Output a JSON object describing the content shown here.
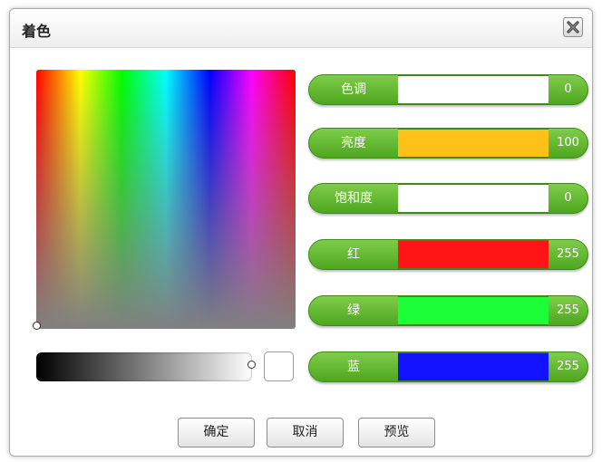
{
  "dialog": {
    "title": "着色",
    "close_icon": "close-x-icon"
  },
  "sliders": [
    {
      "label": "色调",
      "value": "0",
      "track_color": "#ffffff"
    },
    {
      "label": "亮度",
      "value": "100",
      "track_color": "#ffc018"
    },
    {
      "label": "饱和度",
      "value": "0",
      "track_color": "#ffffff"
    },
    {
      "label": "红",
      "value": "255",
      "track_color": "#ff1515"
    },
    {
      "label": "绿",
      "value": "255",
      "track_color": "#1cff38"
    },
    {
      "label": "蓝",
      "value": "255",
      "track_color": "#1212ff"
    }
  ],
  "preview": {
    "color": "#ffffff"
  },
  "buttons": {
    "ok": "确定",
    "cancel": "取消",
    "preview": "预览"
  },
  "colors": {
    "accent_green": "#5db22a"
  }
}
